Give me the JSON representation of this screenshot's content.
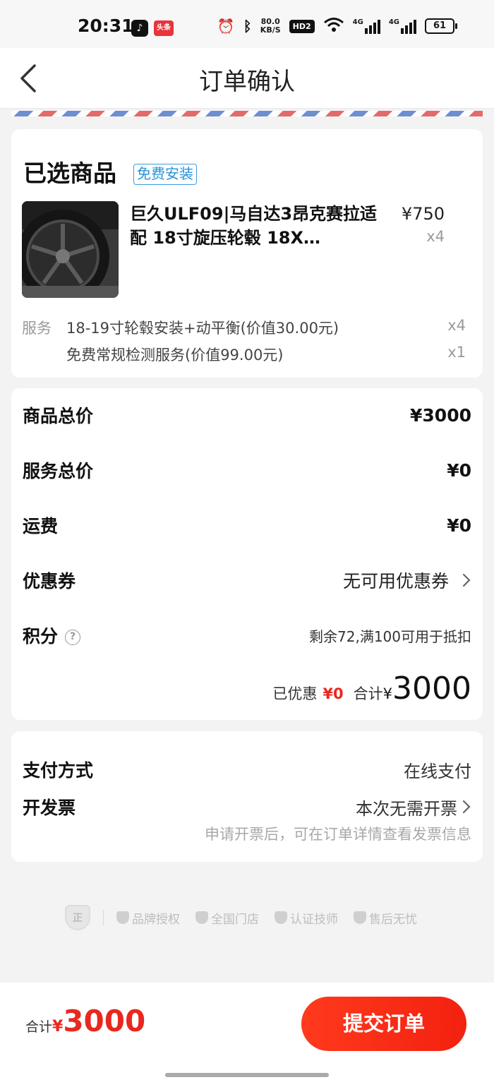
{
  "status_bar": {
    "time": "20:31",
    "net_speed_value": "80.0",
    "net_speed_unit": "KB/S",
    "hd_label": "HD2",
    "signal1": "4G",
    "signal2": "4G",
    "battery": "61"
  },
  "nav": {
    "title": "订单确认"
  },
  "product_card": {
    "title": "已选商品",
    "tag": "免费安装",
    "product": {
      "name": "巨久ULF09|马自达3昂克赛拉适配  18寸旋压轮毂 18X…",
      "price": "¥750",
      "qty": "x4"
    },
    "service_label": "服务",
    "services": [
      {
        "name": "18-19寸轮毂安装+动平衡(价值30.00元)",
        "qty": "x4"
      },
      {
        "name": "免费常规检测服务(价值99.00元)",
        "qty": "x1"
      }
    ]
  },
  "price_card": {
    "goods_total_label": "商品总价",
    "goods_total": "¥3000",
    "service_total_label": "服务总价",
    "service_total": "¥0",
    "shipping_label": "运费",
    "shipping": "¥0",
    "coupon_label": "优惠券",
    "coupon_value": "无可用优惠券",
    "points_label": "积分",
    "points_value": "剩余72,满100可用于抵扣",
    "discount_label": "已优惠",
    "discount_value": "¥0",
    "total_label": "合计",
    "total_currency": "¥",
    "total_amount": "3000"
  },
  "payment_card": {
    "pay_method_label": "支付方式",
    "pay_method_value": "在线支付",
    "invoice_label": "开发票",
    "invoice_value": "本次无需开票",
    "invoice_hint": "申请开票后，可在订单详情查看发票信息"
  },
  "guarantees": {
    "shield_text": "正",
    "items": [
      "品牌授权",
      "全国门店",
      "认证技师",
      "售后无忧"
    ]
  },
  "bottom_bar": {
    "total_label": "合计",
    "currency": "¥",
    "amount": "3000",
    "submit_label": "提交订单"
  },
  "colors": {
    "accent_red": "#e8281f",
    "tag_blue": "#2a92d8",
    "submit_gradient_start": "#ff3a1d",
    "submit_gradient_end": "#f3210f"
  }
}
